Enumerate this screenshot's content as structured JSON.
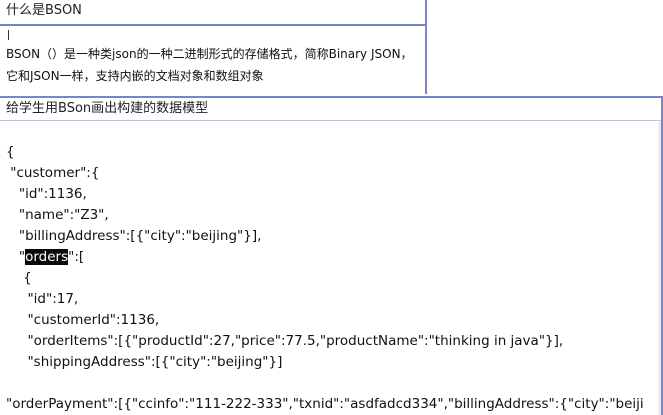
{
  "panel1": {
    "title": "什么是BSON",
    "line1": "BSON（）是一种类json的一种二进制形式的存储格式，简称Binary JSON，",
    "line2": "它和JSON一样，支持内嵌的文档对象和数组对象"
  },
  "panel2": {
    "title": "给学生用BSon画出构建的数据模型",
    "code": {
      "l1": "{",
      "l2": " \"customer\":{",
      "l3": "   \"id\":1136,",
      "l4": "   \"name\":\"Z3\",",
      "l5": "   \"billingAddress\":[{\"city\":\"beijing\"}],",
      "l6_pre": "   \"",
      "l6_hl": "orders",
      "l6_post": "\":[",
      "l7": "    {",
      "l8": "     \"id\":17,",
      "l9": "     \"customerId\":1136,",
      "l10": "     \"orderItems\":[{\"productId\":27,\"price\":77.5,\"productName\":\"thinking in java\"}],",
      "l11": "     \"shippingAddress\":[{\"city\":\"beijing\"}]",
      "l12": "",
      "l13": "\"orderPayment\":[{\"ccinfo\":\"111-222-333\",\"txnid\":\"asdfadcd334\",\"billingAddress\":{\"city\":\"beiji"
    }
  }
}
